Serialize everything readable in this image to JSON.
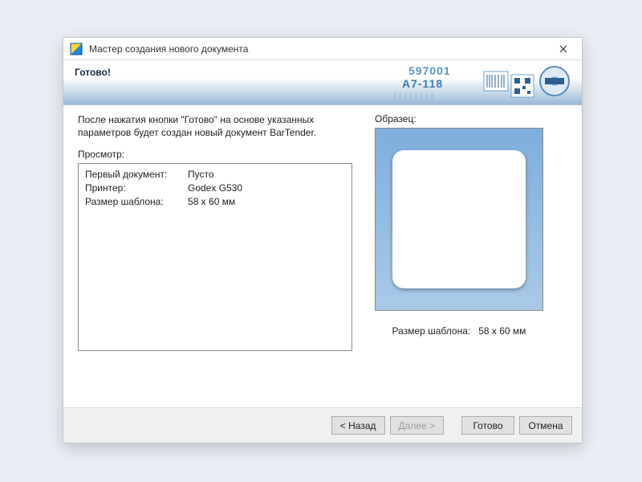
{
  "window": {
    "title": "Мастер создания нового документа"
  },
  "banner": {
    "heading": "Готово!"
  },
  "intro": "После нажатия кнопки \"Готово\" на основе указанных параметров будет создан новый документ BarTender.",
  "review": {
    "label": "Просмотр:",
    "rows": [
      {
        "k": "Первый документ:",
        "v": "Пусто"
      },
      {
        "k": "Принтер:",
        "v": "Godex G530"
      },
      {
        "k": "Размер шаблона:",
        "v": "58 x 60 мм"
      }
    ]
  },
  "sample": {
    "label": "Образец:",
    "caption_key": "Размер шаблона:",
    "caption_val": "58 x 60 мм"
  },
  "buttons": {
    "back": "< Назад",
    "next": "Далее >",
    "finish": "Готово",
    "cancel": "Отмена"
  }
}
